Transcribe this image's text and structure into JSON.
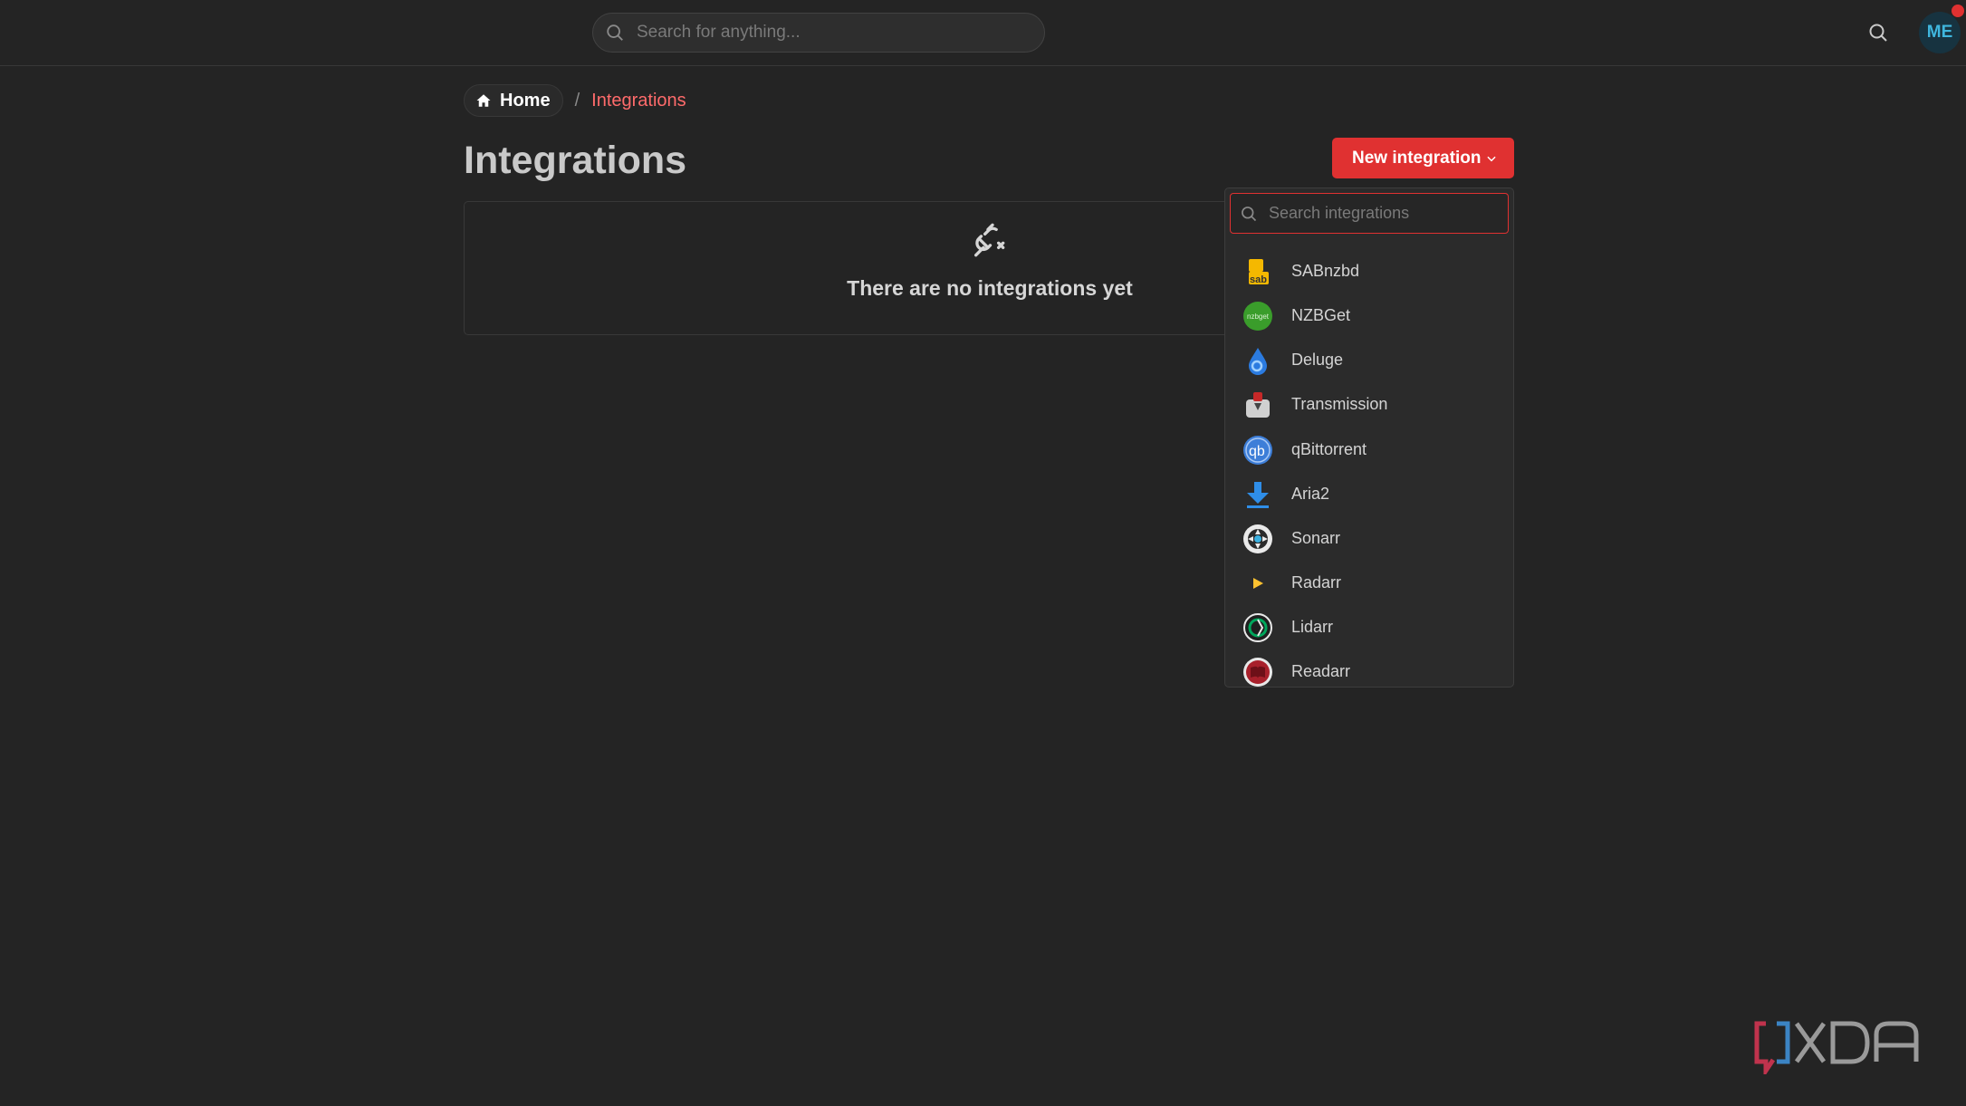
{
  "topbar": {
    "search_placeholder": "Search for anything...",
    "avatar_initials": "ME"
  },
  "breadcrumb": {
    "home_label": "Home",
    "separator": "/",
    "current_label": "Integrations"
  },
  "page": {
    "title": "Integrations",
    "new_button_label": "New integration",
    "empty_message": "There are no integrations yet"
  },
  "dropdown": {
    "search_placeholder": "Search integrations",
    "items": [
      {
        "label": "SABnzbd",
        "icon": "sabnzbd-logo-icon"
      },
      {
        "label": "NZBGet",
        "icon": "nzbget-logo-icon"
      },
      {
        "label": "Deluge",
        "icon": "deluge-logo-icon"
      },
      {
        "label": "Transmission",
        "icon": "transmission-logo-icon"
      },
      {
        "label": "qBittorrent",
        "icon": "qbittorrent-logo-icon"
      },
      {
        "label": "Aria2",
        "icon": "aria2-logo-icon"
      },
      {
        "label": "Sonarr",
        "icon": "sonarr-logo-icon"
      },
      {
        "label": "Radarr",
        "icon": "radarr-logo-icon"
      },
      {
        "label": "Lidarr",
        "icon": "lidarr-logo-icon"
      },
      {
        "label": "Readarr",
        "icon": "readarr-logo-icon"
      }
    ]
  },
  "watermark": {
    "text": "XDA"
  },
  "colors": {
    "background": "#242424",
    "accent": "#e03131",
    "breadcrumb_active": "#ff6b6b",
    "avatar_text": "#3fb6dd"
  }
}
